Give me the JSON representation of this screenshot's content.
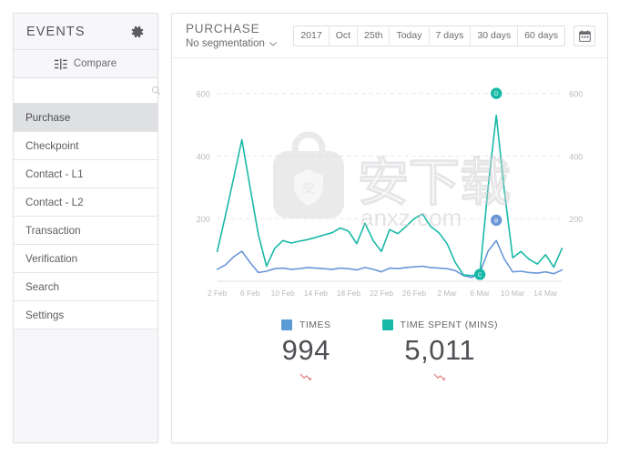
{
  "sidebar": {
    "title": "EVENTS",
    "gear_icon": "gear-icon",
    "compare": {
      "label": "Compare",
      "icon": "sliders-icon"
    },
    "search": {
      "value": "",
      "placeholder": "",
      "icon": "search-icon"
    },
    "items": [
      {
        "label": "Purchase",
        "active": true
      },
      {
        "label": "Checkpoint",
        "active": false
      },
      {
        "label": "Contact - L1",
        "active": false
      },
      {
        "label": "Contact - L2",
        "active": false
      },
      {
        "label": "Transaction",
        "active": false
      },
      {
        "label": "Verification",
        "active": false
      },
      {
        "label": "Search",
        "active": false
      },
      {
        "label": "Settings",
        "active": false
      }
    ]
  },
  "panel": {
    "title": "PURCHASE",
    "segmentation": "No segmentation",
    "segmentation_icon": "chevron-down-icon",
    "ranges": [
      "2017",
      "Oct",
      "25th",
      "Today",
      "7 days",
      "30 days",
      "60 days"
    ],
    "calendar_icon": "calendar-icon"
  },
  "stats": [
    {
      "label": "TIMES",
      "value": "994",
      "color": "#5b9bd5",
      "trend": "down"
    },
    {
      "label": "TIME SPENT (MINS)",
      "value": "5,011",
      "color": "#17b8a6",
      "trend": "down"
    }
  ],
  "colors": {
    "times": "#6a96d8",
    "time_spent": "#17b8a6",
    "trend_down": "#e08a8a",
    "sidebar_bg": "#f7f7f9",
    "active_item": "#dfe0e2",
    "grid": "#e8e8ec",
    "axis_text": "#b9babe"
  },
  "annotations": [
    {
      "id": "D",
      "series": "time_spent",
      "x_index": 34,
      "value": 600,
      "color": "#17b8a6"
    },
    {
      "id": "B",
      "series": "times",
      "x_index": 34,
      "value": 195,
      "color": "#6a96d8"
    },
    {
      "id": "C",
      "series": "time_spent",
      "x_index": 32,
      "value": 22,
      "color": "#17b8a6"
    }
  ],
  "chart_data": {
    "type": "line",
    "title": "PURCHASE",
    "xlabel": "",
    "ylabel": "",
    "ylim": [
      0,
      660
    ],
    "y_ticks": [
      200,
      400,
      600
    ],
    "right_y_ticks": [
      200,
      400,
      600
    ],
    "grid": true,
    "legend": "bottom",
    "x_tick_labels": [
      "2 Feb",
      "6 Feb",
      "10 Feb",
      "14 Feb",
      "18 Feb",
      "22 Feb",
      "26 Feb",
      "2 Mar",
      "6 Mar",
      "10 Mar",
      "14 Mar"
    ],
    "x_tick_indices": [
      0,
      4,
      8,
      12,
      16,
      20,
      24,
      28,
      32,
      36,
      40
    ],
    "series": [
      {
        "name": "TIME SPENT (MINS)",
        "color": "#17b8a6",
        "values": [
          95,
          210,
          330,
          452,
          300,
          150,
          48,
          105,
          130,
          122,
          128,
          133,
          140,
          148,
          155,
          170,
          160,
          120,
          185,
          130,
          95,
          165,
          152,
          175,
          200,
          215,
          175,
          155,
          120,
          60,
          20,
          18,
          22,
          300,
          530,
          285,
          75,
          95,
          70,
          55,
          85,
          45,
          105
        ]
      },
      {
        "name": "TIMES",
        "color": "#6a96d8",
        "values": [
          38,
          52,
          78,
          96,
          60,
          28,
          32,
          40,
          42,
          38,
          40,
          44,
          42,
          40,
          38,
          42,
          40,
          36,
          44,
          38,
          30,
          42,
          40,
          44,
          46,
          48,
          44,
          42,
          40,
          34,
          18,
          12,
          26,
          96,
          130,
          70,
          30,
          32,
          28,
          26,
          30,
          24,
          36
        ]
      }
    ]
  }
}
